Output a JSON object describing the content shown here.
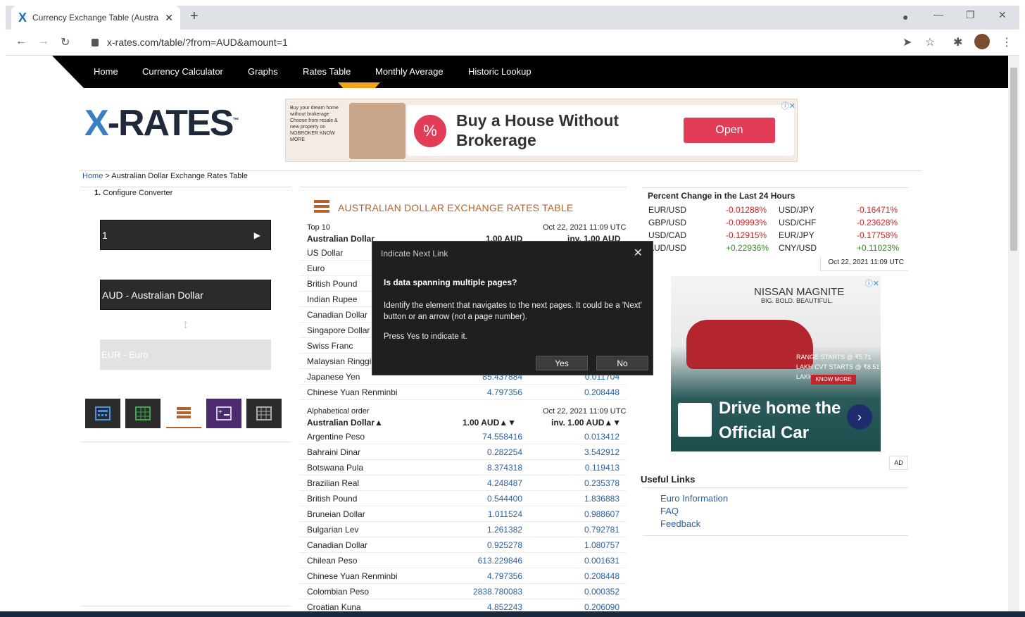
{
  "browser": {
    "tab_title": "Currency Exchange Table (Austra",
    "url": "x-rates.com/table/?from=AUD&amount=1"
  },
  "nav": {
    "items": [
      "Home",
      "Currency Calculator",
      "Graphs",
      "Rates Table",
      "Monthly Average",
      "Historic Lookup"
    ],
    "active": "Rates Table"
  },
  "logo": {
    "x": "X",
    "rest": "-RATES",
    "tm": "™"
  },
  "top_ad": {
    "small": "Buy your dream home without brokerage Choose from resale & new property on NOBROKER KNOW MORE",
    "headline": "Buy a House Without Brokerage",
    "cta": "Open"
  },
  "breadcrumb": {
    "home": "Home",
    "sep": " > ",
    "current": "Australian Dollar Exchange Rates Table"
  },
  "converter": {
    "step_num": "1.",
    "step_label": "Configure Converter",
    "amount": "1",
    "from": "AUD - Australian Dollar",
    "to": "EUR - Euro"
  },
  "table": {
    "title": "AUSTRALIAN DOLLAR EXCHANGE RATES TABLE",
    "top10_label": "Top 10",
    "date": "Oct 22, 2021 11:09 UTC",
    "base": "Australian Dollar",
    "col1": "1.00 AUD",
    "col2": "inv. 1.00 AUD",
    "top10": [
      {
        "name": "US Dollar",
        "v1": "",
        "v2": ""
      },
      {
        "name": "Euro",
        "v1": "",
        "v2": ""
      },
      {
        "name": "British Pound",
        "v1": "",
        "v2": ""
      },
      {
        "name": "Indian Rupee",
        "v1": "",
        "v2": ""
      },
      {
        "name": "Canadian Dollar",
        "v1": "",
        "v2": ""
      },
      {
        "name": "Singapore Dollar",
        "v1": "",
        "v2": ""
      },
      {
        "name": "Swiss Franc",
        "v1": "",
        "v2": ""
      },
      {
        "name": "Malaysian Ringgit",
        "v1": "",
        "v2": ""
      },
      {
        "name": "Japanese Yen",
        "v1": "85.437884",
        "v2": "0.011704"
      },
      {
        "name": "Chinese Yuan Renminbi",
        "v1": "4.797356",
        "v2": "0.208448"
      }
    ],
    "alpha_label": "Alphabetical order",
    "alpha_base": "Australian Dollar▲",
    "alpha_col1": "1.00 AUD▲▼",
    "alpha_col2": "inv. 1.00 AUD▲▼",
    "alpha": [
      {
        "name": "Argentine Peso",
        "v1": "74.558416",
        "v2": "0.013412"
      },
      {
        "name": "Bahraini Dinar",
        "v1": "0.282254",
        "v2": "3.542912"
      },
      {
        "name": "Botswana Pula",
        "v1": "8.374318",
        "v2": "0.119413"
      },
      {
        "name": "Brazilian Real",
        "v1": "4.248487",
        "v2": "0.235378"
      },
      {
        "name": "British Pound",
        "v1": "0.544400",
        "v2": "1.836883"
      },
      {
        "name": "Bruneian Dollar",
        "v1": "1.011524",
        "v2": "0.988607"
      },
      {
        "name": "Bulgarian Lev",
        "v1": "1.261382",
        "v2": "0.792781"
      },
      {
        "name": "Canadian Dollar",
        "v1": "0.925278",
        "v2": "1.080757"
      },
      {
        "name": "Chilean Peso",
        "v1": "613.229846",
        "v2": "0.001631"
      },
      {
        "name": "Chinese Yuan Renminbi",
        "v1": "4.797356",
        "v2": "0.208448"
      },
      {
        "name": "Colombian Peso",
        "v1": "2838.780083",
        "v2": "0.000352"
      },
      {
        "name": "Croatian Kuna",
        "v1": "4.852243",
        "v2": "0.206090"
      }
    ]
  },
  "percent": {
    "title": "Percent Change in the Last 24 Hours",
    "rows": [
      {
        "p1": "EUR/USD",
        "c1": "-0.01288%",
        "p2": "USD/JPY",
        "c2": "-0.16471%"
      },
      {
        "p1": "GBP/USD",
        "c1": "-0.09993%",
        "p2": "USD/CHF",
        "c2": "-0.23628%"
      },
      {
        "p1": "USD/CAD",
        "c1": "-0.12915%",
        "p2": "EUR/JPY",
        "c2": "-0.17758%"
      },
      {
        "p1": "AUD/USD",
        "c1": "+0.22936%",
        "p2": "CNY/USD",
        "c2": "+0.11023%"
      }
    ],
    "timestamp": "Oct 22, 2021 11:09 UTC"
  },
  "side_ad": {
    "brand": "NISSAN MAGNITE",
    "tag": "BIG. BOLD. BEAUTIFUL.",
    "price": "RANGE STARTS @ ₹5.71 LAKH CVT STARTS @ ₹8.51 LAKH",
    "cta": "KNOW MORE",
    "headline": "Drive home the Official Car",
    "label": "AD"
  },
  "useful": {
    "title": "Useful Links",
    "links": [
      "Euro Information",
      "FAQ",
      "Feedback"
    ]
  },
  "dialog": {
    "title": "Indicate Next Link",
    "question": "Is data spanning multiple pages?",
    "body": "Identify the element that navigates to the next pages. It could be a 'Next' button or an arrow (not a page number).",
    "prompt": "Press Yes to indicate it.",
    "yes": "Yes",
    "no": "No"
  },
  "colors": {
    "accent": "#b5622d",
    "nav_active": "#f7a21b",
    "link": "#2a62a8"
  }
}
